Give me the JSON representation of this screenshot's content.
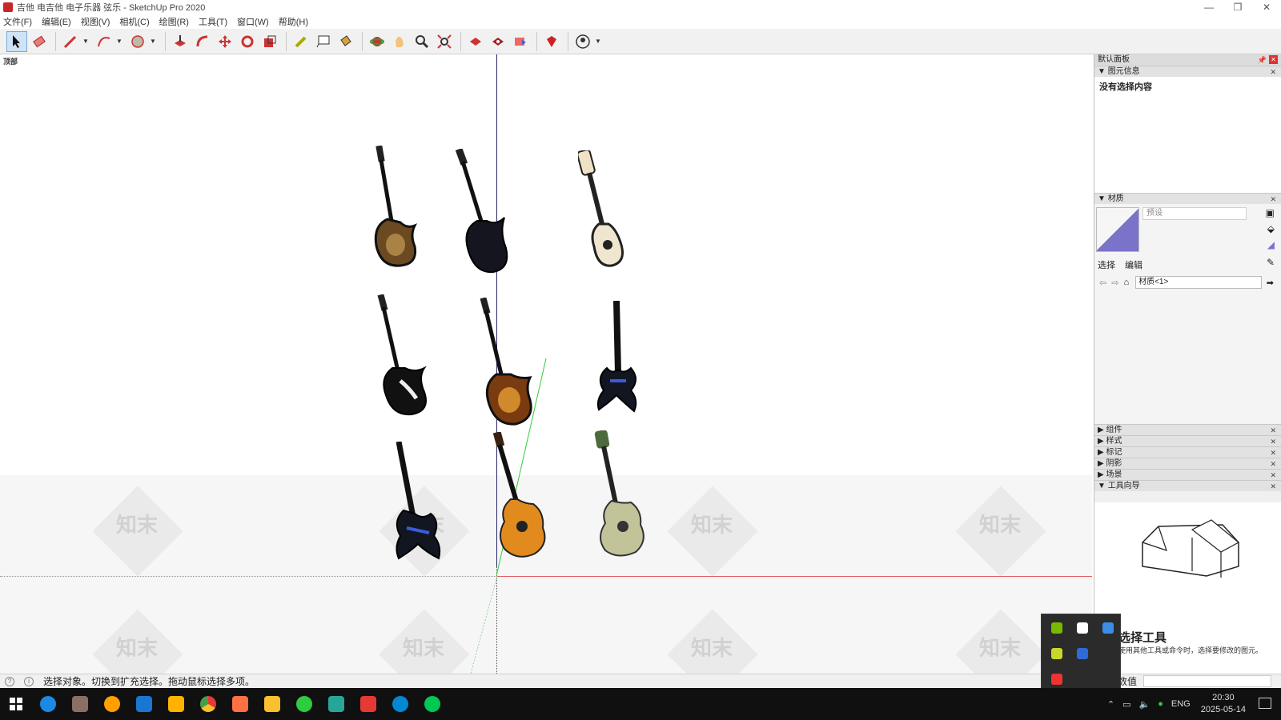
{
  "window": {
    "title": "吉他 电吉他 电子乐器 弦乐 - SketchUp Pro 2020",
    "minimize": "—",
    "restore": "❐",
    "close": "✕"
  },
  "menu": [
    "文件(F)",
    "编辑(E)",
    "视图(V)",
    "相机(C)",
    "绘图(R)",
    "工具(T)",
    "窗口(W)",
    "帮助(H)"
  ],
  "toolbar": {
    "tools": [
      "select-icon",
      "eraser-icon",
      "pencil-icon",
      "arc-icon",
      "circle-icon",
      "push-pull-icon",
      "offset-icon",
      "move-icon",
      "rotate-icon",
      "scale-icon",
      "tape-measure-icon",
      "text-icon",
      "paint-bucket-icon",
      "orbit-icon",
      "pan-icon",
      "zoom-icon",
      "zoom-extents-icon",
      "warehouse-icon",
      "extension-warehouse-icon",
      "layout-icon",
      "ruby-icon",
      "account-icon"
    ]
  },
  "viewport": {
    "scene_label": "顶部",
    "watermark": "知末"
  },
  "tray": {
    "title": "默认面板",
    "pin": "📌",
    "entity_info": {
      "header": "图元信息",
      "empty_text": "没有选择内容"
    },
    "materials": {
      "header": "材质",
      "preset_placeholder": "预设",
      "tab_select": "选择",
      "tab_edit": "编辑",
      "library": "材质<1>"
    },
    "collapsed_sections": [
      "组件",
      "样式",
      "标记",
      "阴影",
      "场景"
    ],
    "instructor": {
      "header": "工具向导",
      "title": "选择工具",
      "desc": "使用其他工具或命令时，选择要修改的图元。"
    }
  },
  "statusbar": {
    "hint": "选择对象。切换到扩充选择。拖动鼠标选择多项。",
    "measure_label": "数值"
  },
  "taskbar": {
    "apps": [
      "start-icon",
      "edge-icon",
      "photos-icon",
      "media-icon",
      "security-icon",
      "player-icon",
      "chrome-icon",
      "design-icon",
      "explorer-icon",
      "wechat-icon",
      "app3-icon",
      "sketchup-icon",
      "browser-icon",
      "app-green-icon"
    ],
    "lang": "ENG",
    "time": "20:30",
    "date": "2025-05-14"
  }
}
